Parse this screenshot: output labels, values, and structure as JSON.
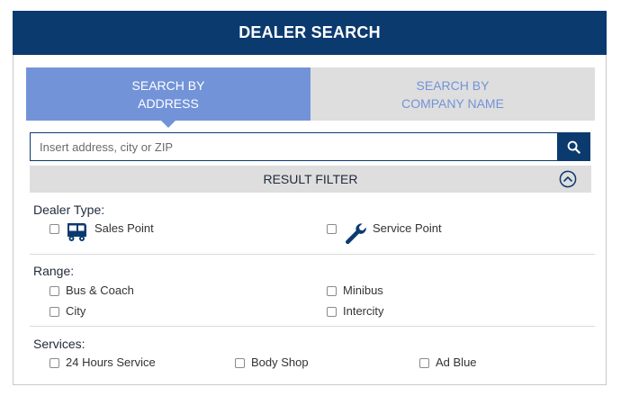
{
  "header": {
    "title": "DEALER SEARCH"
  },
  "tabs": [
    {
      "label_line1": "SEARCH BY",
      "label_line2": "ADDRESS",
      "active": true
    },
    {
      "label_line1": "SEARCH BY",
      "label_line2": "COMPANY NAME",
      "active": false
    }
  ],
  "search": {
    "placeholder": "Insert address, city or ZIP",
    "value": "",
    "button_icon": "search-icon"
  },
  "filter": {
    "label": "RESULT FILTER",
    "toggle_icon": "chevron-up-circle-icon"
  },
  "dealer_type": {
    "title": "Dealer Type:",
    "options": [
      {
        "label": "Sales Point",
        "icon": "bus-icon",
        "checked": false
      },
      {
        "label": "Service Point",
        "icon": "wrench-icon",
        "checked": false
      }
    ]
  },
  "range": {
    "title": "Range:",
    "options": [
      {
        "label": "Bus & Coach",
        "checked": false
      },
      {
        "label": "Minibus",
        "checked": false
      },
      {
        "label": "City",
        "checked": false
      },
      {
        "label": "Intercity",
        "checked": false
      }
    ]
  },
  "services": {
    "title": "Services:",
    "options": [
      {
        "label": "24 Hours Service",
        "checked": false
      },
      {
        "label": "Body Shop",
        "checked": false
      },
      {
        "label": "Ad Blue",
        "checked": false
      }
    ]
  },
  "colors": {
    "header_bg": "#0b3a6f",
    "active_tab": "#7393d8",
    "inactive_tab_bg": "#dedede"
  }
}
